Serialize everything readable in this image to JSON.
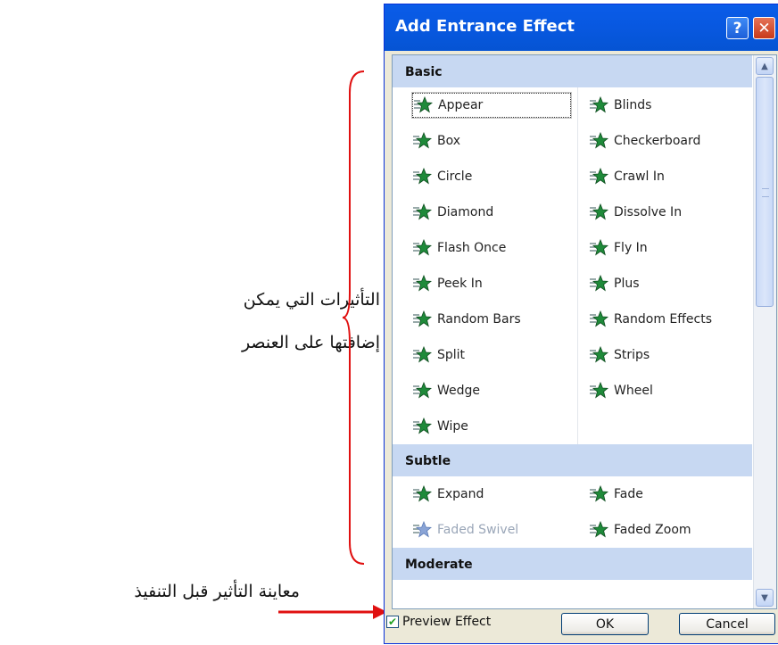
{
  "annotations": {
    "effects_note": "التأثيرات التي يمكن إضافتها على العنصر",
    "preview_note": "معاينة التأثير قبل التنفيذ"
  },
  "colors": {
    "bracket": "#e01010",
    "arrow": "#e01010",
    "accent": "#0a5ce8"
  },
  "dialog": {
    "title": "Add Entrance Effect",
    "help_glyph": "?",
    "close_glyph": "✕",
    "categories": [
      {
        "name": "Basic",
        "items": [
          {
            "label": "Appear",
            "icon": "appear-star-icon"
          },
          {
            "label": "Blinds",
            "icon": "blinds-star-icon"
          },
          {
            "label": "Box",
            "icon": "box-star-icon"
          },
          {
            "label": "Checkerboard",
            "icon": "checkerboard-star-icon"
          },
          {
            "label": "Circle",
            "icon": "circle-star-icon"
          },
          {
            "label": "Crawl In",
            "icon": "crawl-in-star-icon"
          },
          {
            "label": "Diamond",
            "icon": "diamond-star-icon"
          },
          {
            "label": "Dissolve In",
            "icon": "dissolve-star-icon"
          },
          {
            "label": "Flash Once",
            "icon": "flash-star-icon"
          },
          {
            "label": "Fly In",
            "icon": "fly-in-star-icon"
          },
          {
            "label": "Peek In",
            "icon": "peek-in-star-icon"
          },
          {
            "label": "Plus",
            "icon": "plus-star-icon"
          },
          {
            "label": "Random Bars",
            "icon": "random-bars-star-icon"
          },
          {
            "label": "Random Effects",
            "icon": "random-effects-star-icon"
          },
          {
            "label": "Split",
            "icon": "split-star-icon"
          },
          {
            "label": "Strips",
            "icon": "strips-star-icon"
          },
          {
            "label": "Wedge",
            "icon": "wedge-star-icon"
          },
          {
            "label": "Wheel",
            "icon": "wheel-star-icon"
          },
          {
            "label": "Wipe",
            "icon": "wipe-star-icon"
          }
        ]
      },
      {
        "name": "Subtle",
        "items": [
          {
            "label": "Expand",
            "icon": "expand-star-icon"
          },
          {
            "label": "Fade",
            "icon": "fade-star-icon"
          },
          {
            "label": "Faded Swivel",
            "icon": "faded-swivel-star-icon"
          },
          {
            "label": "Faded Zoom",
            "icon": "faded-zoom-star-icon"
          }
        ]
      },
      {
        "name": "Moderate",
        "items": []
      }
    ],
    "selected_item": "Appear",
    "disabled_item": "Faded Swivel",
    "preview_checkbox": {
      "label": "Preview Effect",
      "checked": true
    },
    "ok_label": "OK",
    "cancel_label": "Cancel"
  }
}
